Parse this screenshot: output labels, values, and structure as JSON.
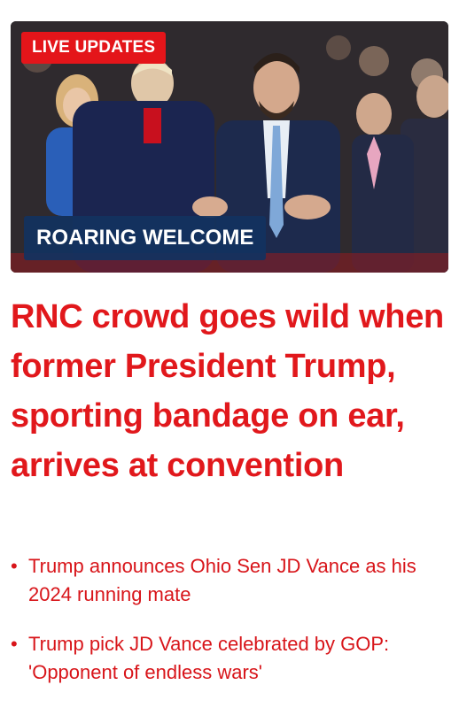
{
  "hero": {
    "live_badge": "LIVE UPDATES",
    "caption_badge": "ROARING WELCOME"
  },
  "headline": "RNC crowd goes wild when former President Trump, sporting bandage on ear, arrives at convention",
  "related": [
    {
      "bullet": "•",
      "text": "Trump announces Ohio Sen JD Vance as his 2024 running mate"
    },
    {
      "bullet": "•",
      "text": "Trump pick JD Vance celebrated by GOP: 'Opponent of endless wars'"
    }
  ],
  "colors": {
    "headline": "#e1181c",
    "live_badge_bg": "#e4151a",
    "caption_badge_bg": "#12325f"
  }
}
